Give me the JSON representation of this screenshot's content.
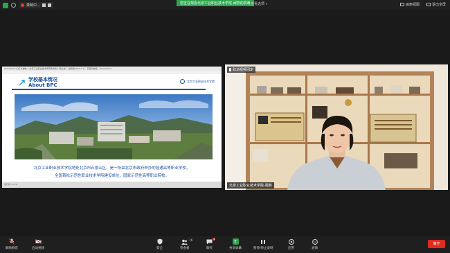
{
  "topbar": {
    "recording_label": "录制中...",
    "banner_text": "您正在观看北京工业职业技术学院-闽燕的屏幕",
    "view_options": "查看选项",
    "gallery_view": "画廊视图",
    "exit_fullscreen": "退出全屏"
  },
  "share": {
    "window_title": "PowerPoint 幻灯片放映 - [北京工业职业技术学院学校简介(英文版)（最终版2023.7.2) - 已自动恢复] - PowerPoint",
    "slide_title_cn": "学校基本情况",
    "slide_title_en": "About BPC",
    "logo_text": "北京工业职业技术学院",
    "caption_line1": "北京工业职业技术学院地处北京市石景山区，是一所由北京市政府举办的普通高等职业学校，",
    "caption_line2": "全国首批示范性职业技术学院建设单位、国家示范性高等职业院校。",
    "status_text": "幻灯片 4 / 25"
  },
  "video": {
    "unmute_label": "取消视频固定",
    "participant_name": "北京工业职业技术学院-闽燕"
  },
  "toolbar": {
    "mute": "解除静音",
    "start_video": "启动视频",
    "security": "安全",
    "participants": "参会者",
    "participants_count": "16",
    "chat": "聊天",
    "chat_badge": "1",
    "share_screen": "共享屏幕",
    "record": "暂停/停止录制",
    "reactions": "表情",
    "apps": "应用",
    "leave": "离开"
  },
  "colors": {
    "accent_green": "#2ea44f",
    "leave_red": "#e02b20",
    "slide_blue": "#1c4f9e"
  }
}
